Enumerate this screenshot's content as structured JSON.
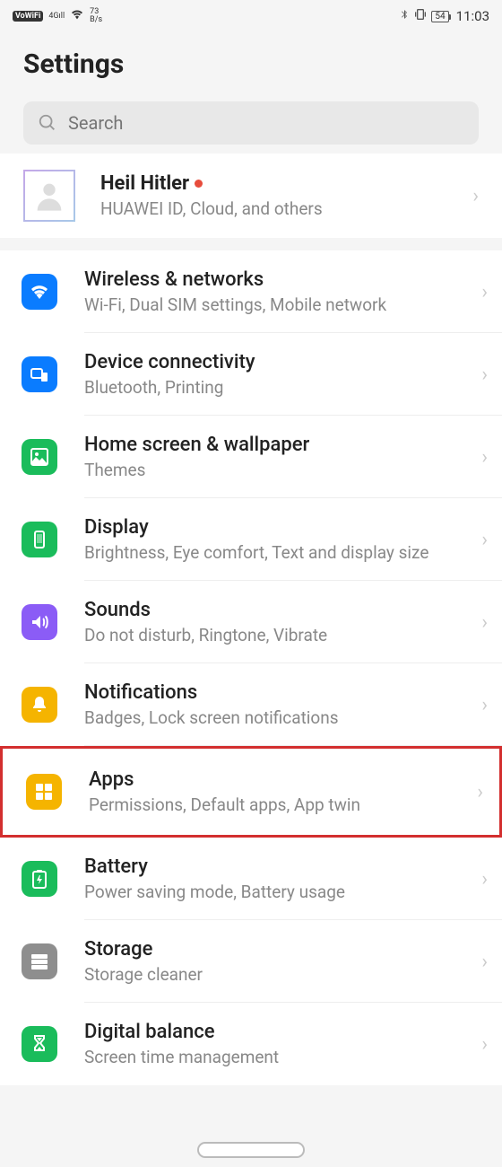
{
  "status_bar": {
    "vowifi": "VoWiFi",
    "net_type": "4G",
    "net_speed_top": "73",
    "net_speed_bottom": "B/s",
    "battery": "54",
    "time": "11:03"
  },
  "header": {
    "title": "Settings"
  },
  "search": {
    "placeholder": "Search"
  },
  "profile": {
    "name": "Heil Hitler",
    "subtitle": "HUAWEI ID, Cloud, and others"
  },
  "items": [
    {
      "id": "wireless",
      "title": "Wireless & networks",
      "sub": "Wi-Fi, Dual SIM settings, Mobile network",
      "color": "ic-blue",
      "icon": "wifi"
    },
    {
      "id": "connectivity",
      "title": "Device connectivity",
      "sub": "Bluetooth, Printing",
      "color": "ic-blue",
      "icon": "devices"
    },
    {
      "id": "home-wallpaper",
      "title": "Home screen & wallpaper",
      "sub": "Themes",
      "color": "ic-green",
      "icon": "image"
    },
    {
      "id": "display",
      "title": "Display",
      "sub": "Brightness, Eye comfort, Text and display size",
      "color": "ic-green",
      "icon": "phone"
    },
    {
      "id": "sounds",
      "title": "Sounds",
      "sub": "Do not disturb, Ringtone, Vibrate",
      "color": "ic-purple",
      "icon": "sound"
    },
    {
      "id": "notifications",
      "title": "Notifications",
      "sub": "Badges, Lock screen notifications",
      "color": "ic-yellow",
      "icon": "bell"
    },
    {
      "id": "apps",
      "title": "Apps",
      "sub": "Permissions, Default apps, App twin",
      "color": "ic-yellow",
      "icon": "apps",
      "highlight": true
    },
    {
      "id": "battery",
      "title": "Battery",
      "sub": "Power saving mode, Battery usage",
      "color": "ic-green",
      "icon": "battery"
    },
    {
      "id": "storage",
      "title": "Storage",
      "sub": "Storage cleaner",
      "color": "ic-grey",
      "icon": "storage"
    },
    {
      "id": "digital",
      "title": "Digital balance",
      "sub": "Screen time management",
      "color": "ic-green",
      "icon": "hourglass"
    }
  ]
}
